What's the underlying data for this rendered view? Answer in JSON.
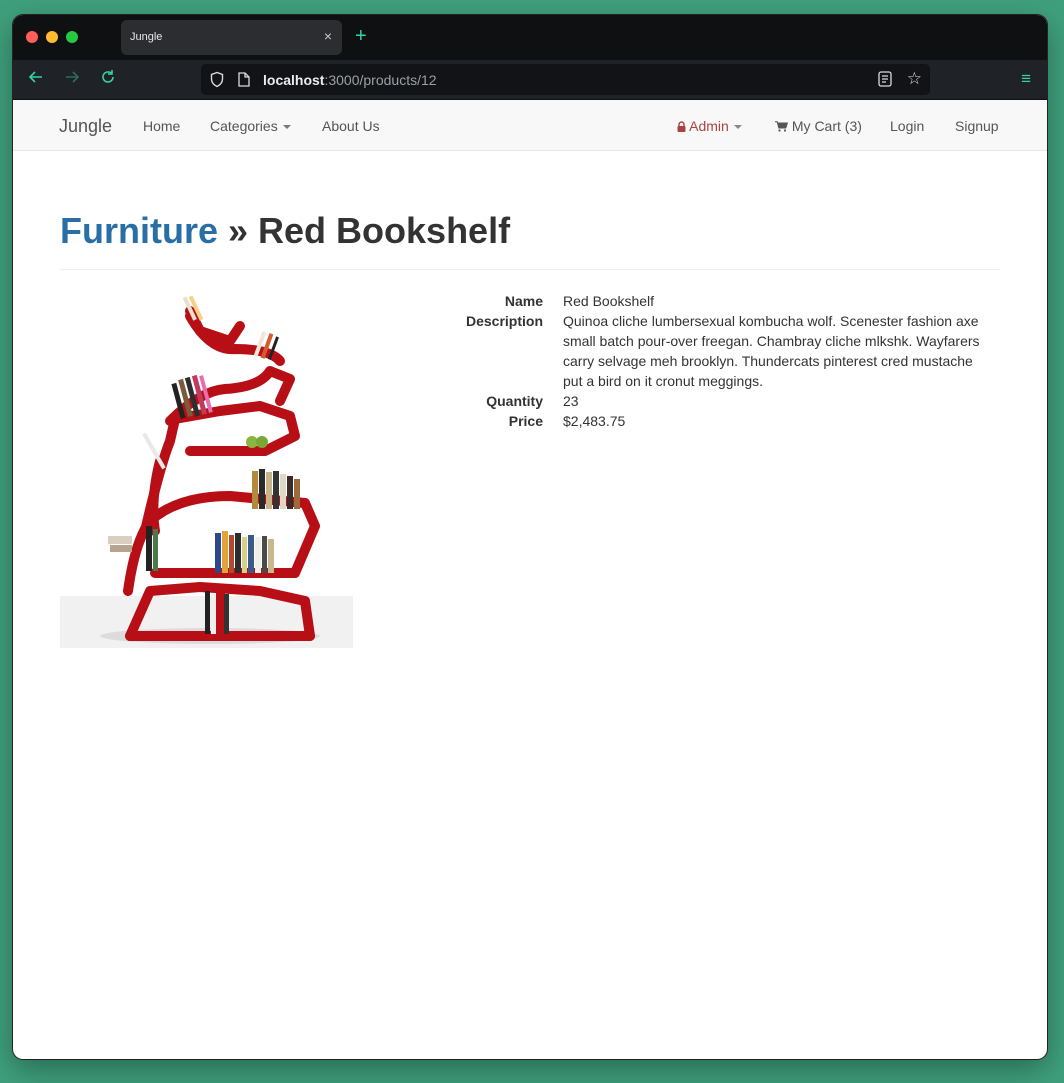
{
  "browser": {
    "tab_title": "Jungle",
    "tab_close": "×",
    "new_tab": "+",
    "url_host": "localhost",
    "url_path": ":3000/products/12"
  },
  "navbar": {
    "brand": "Jungle",
    "links": {
      "home": "Home",
      "categories": "Categories",
      "about": "About Us",
      "admin": "Admin",
      "cart": "My Cart (3)",
      "login": "Login",
      "signup": "Signup"
    }
  },
  "product": {
    "category": "Furniture",
    "separator": " » ",
    "title": "Red Bookshelf",
    "details": [
      {
        "label": "Name",
        "value": "Red Bookshelf"
      },
      {
        "label": "Description",
        "value": "Quinoa cliche lumbersexual kombucha wolf. Scenester fashion axe small batch pour-over freegan. Chambray cliche mlkshk. Wayfarers carry selvage meh brooklyn. Thundercats pinterest cred mustache put a bird on it cronut meggings."
      },
      {
        "label": "Quantity",
        "value": "23"
      },
      {
        "label": "Price",
        "value": "$2,483.75"
      }
    ]
  },
  "colors": {
    "link": "#2a6ea6",
    "admin": "#a94442",
    "browser_accent": "#37d0a8",
    "shelf_red": "#b80f16"
  }
}
